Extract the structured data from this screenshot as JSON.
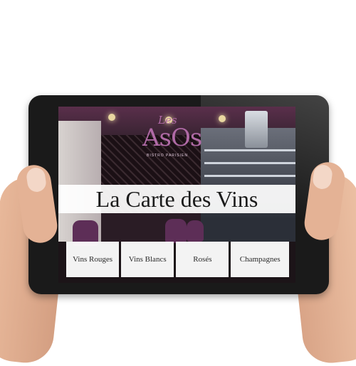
{
  "logo": {
    "top_text": "Les",
    "main_text": "AsOs",
    "subtitle": "BISTRO PARISIEN"
  },
  "page": {
    "title": "La Carte des Vins"
  },
  "menu": {
    "items": [
      {
        "label": "Vins Rouges"
      },
      {
        "label": "Vins Blancs"
      },
      {
        "label": "Rosés"
      },
      {
        "label": "Champagnes"
      }
    ]
  },
  "colors": {
    "logo_accent": "#b06aa6",
    "title_band": "#ffffff",
    "tablet_frame": "#1a1a1a"
  }
}
